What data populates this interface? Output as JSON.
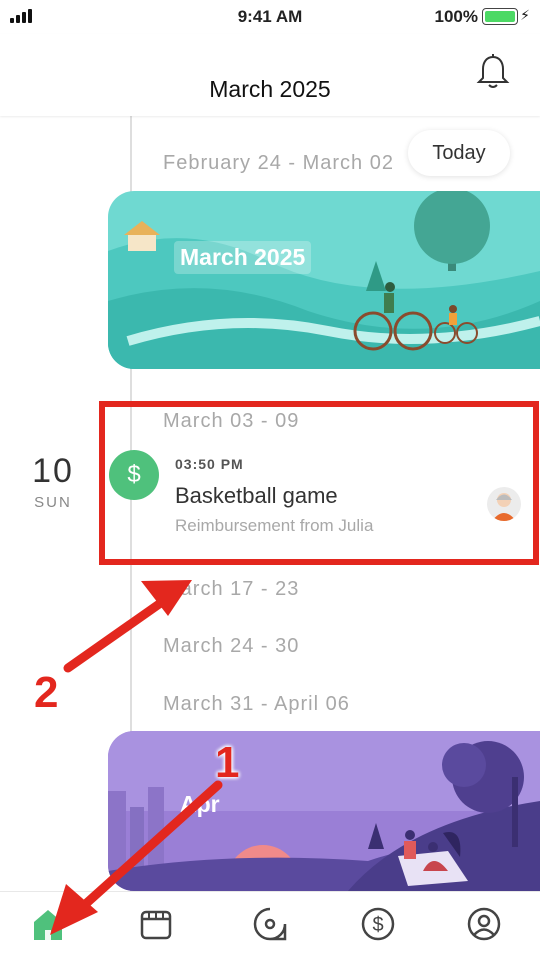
{
  "status_bar": {
    "time": "9:41 AM",
    "battery": "100%"
  },
  "header": {
    "title": "March 2025",
    "icon": "bell-icon"
  },
  "today_button": "Today",
  "weeks": {
    "feb24": "February 24 - March 02",
    "mar03": "March 03 - 09",
    "mar17": "March 17 - 23",
    "mar24": "March 24 - 30",
    "mar31": "March 31 - April 06"
  },
  "banners": {
    "march": "March 2025",
    "april": "Apr"
  },
  "event": {
    "day": "10",
    "weekday": "SUN",
    "icon_symbol": "$",
    "time": "03:50 PM",
    "title": "Basketball game",
    "subtitle": "Reimbursement from Julia"
  },
  "tabs": [
    {
      "name": "home-icon",
      "active": true
    },
    {
      "name": "calendar-icon"
    },
    {
      "name": "explore-icon"
    },
    {
      "name": "dollar-icon"
    },
    {
      "name": "profile-icon"
    }
  ],
  "annotations": {
    "label_1": "1",
    "label_2": "2"
  },
  "colors": {
    "accent": "#4fc17c",
    "annotation": "#e3271e",
    "muted_text": "#a8a8a8"
  }
}
